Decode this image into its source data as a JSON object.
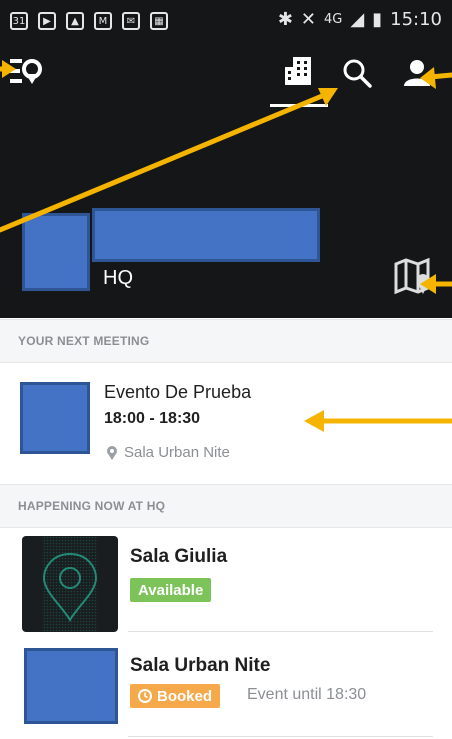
{
  "status_bar": {
    "time": "15:10",
    "network": "4G",
    "left_icons": [
      "calendar-31-icon",
      "youtube-icon",
      "gallery-icon",
      "gmail-icon",
      "messages-icon",
      "calendar-icon"
    ]
  },
  "toolbar": {
    "left_icon": "location-menu-icon",
    "building_icon": "building-icon",
    "search_icon": "search-icon",
    "profile_icon": "person-icon"
  },
  "location": {
    "label": "HQ",
    "map_icon": "map-pin-icon"
  },
  "next_meeting": {
    "section_title": "YOUR NEXT MEETING",
    "title": "Evento De Prueba",
    "time": "18:00 - 18:30",
    "room": "Sala Urban Nite"
  },
  "happening_now": {
    "section_title": "HAPPENING NOW AT HQ",
    "rooms": [
      {
        "name": "Sala Giulia",
        "status": "Available",
        "note": ""
      },
      {
        "name": "Sala Urban Nite",
        "status": "Booked",
        "note": "Event until 18:30"
      }
    ]
  },
  "colors": {
    "header_bg": "#141617",
    "accent_arrow": "#f4b400",
    "redaction_blue": "#4472c4",
    "available_green": "#7cc35a",
    "booked_orange": "#f5a94b"
  }
}
